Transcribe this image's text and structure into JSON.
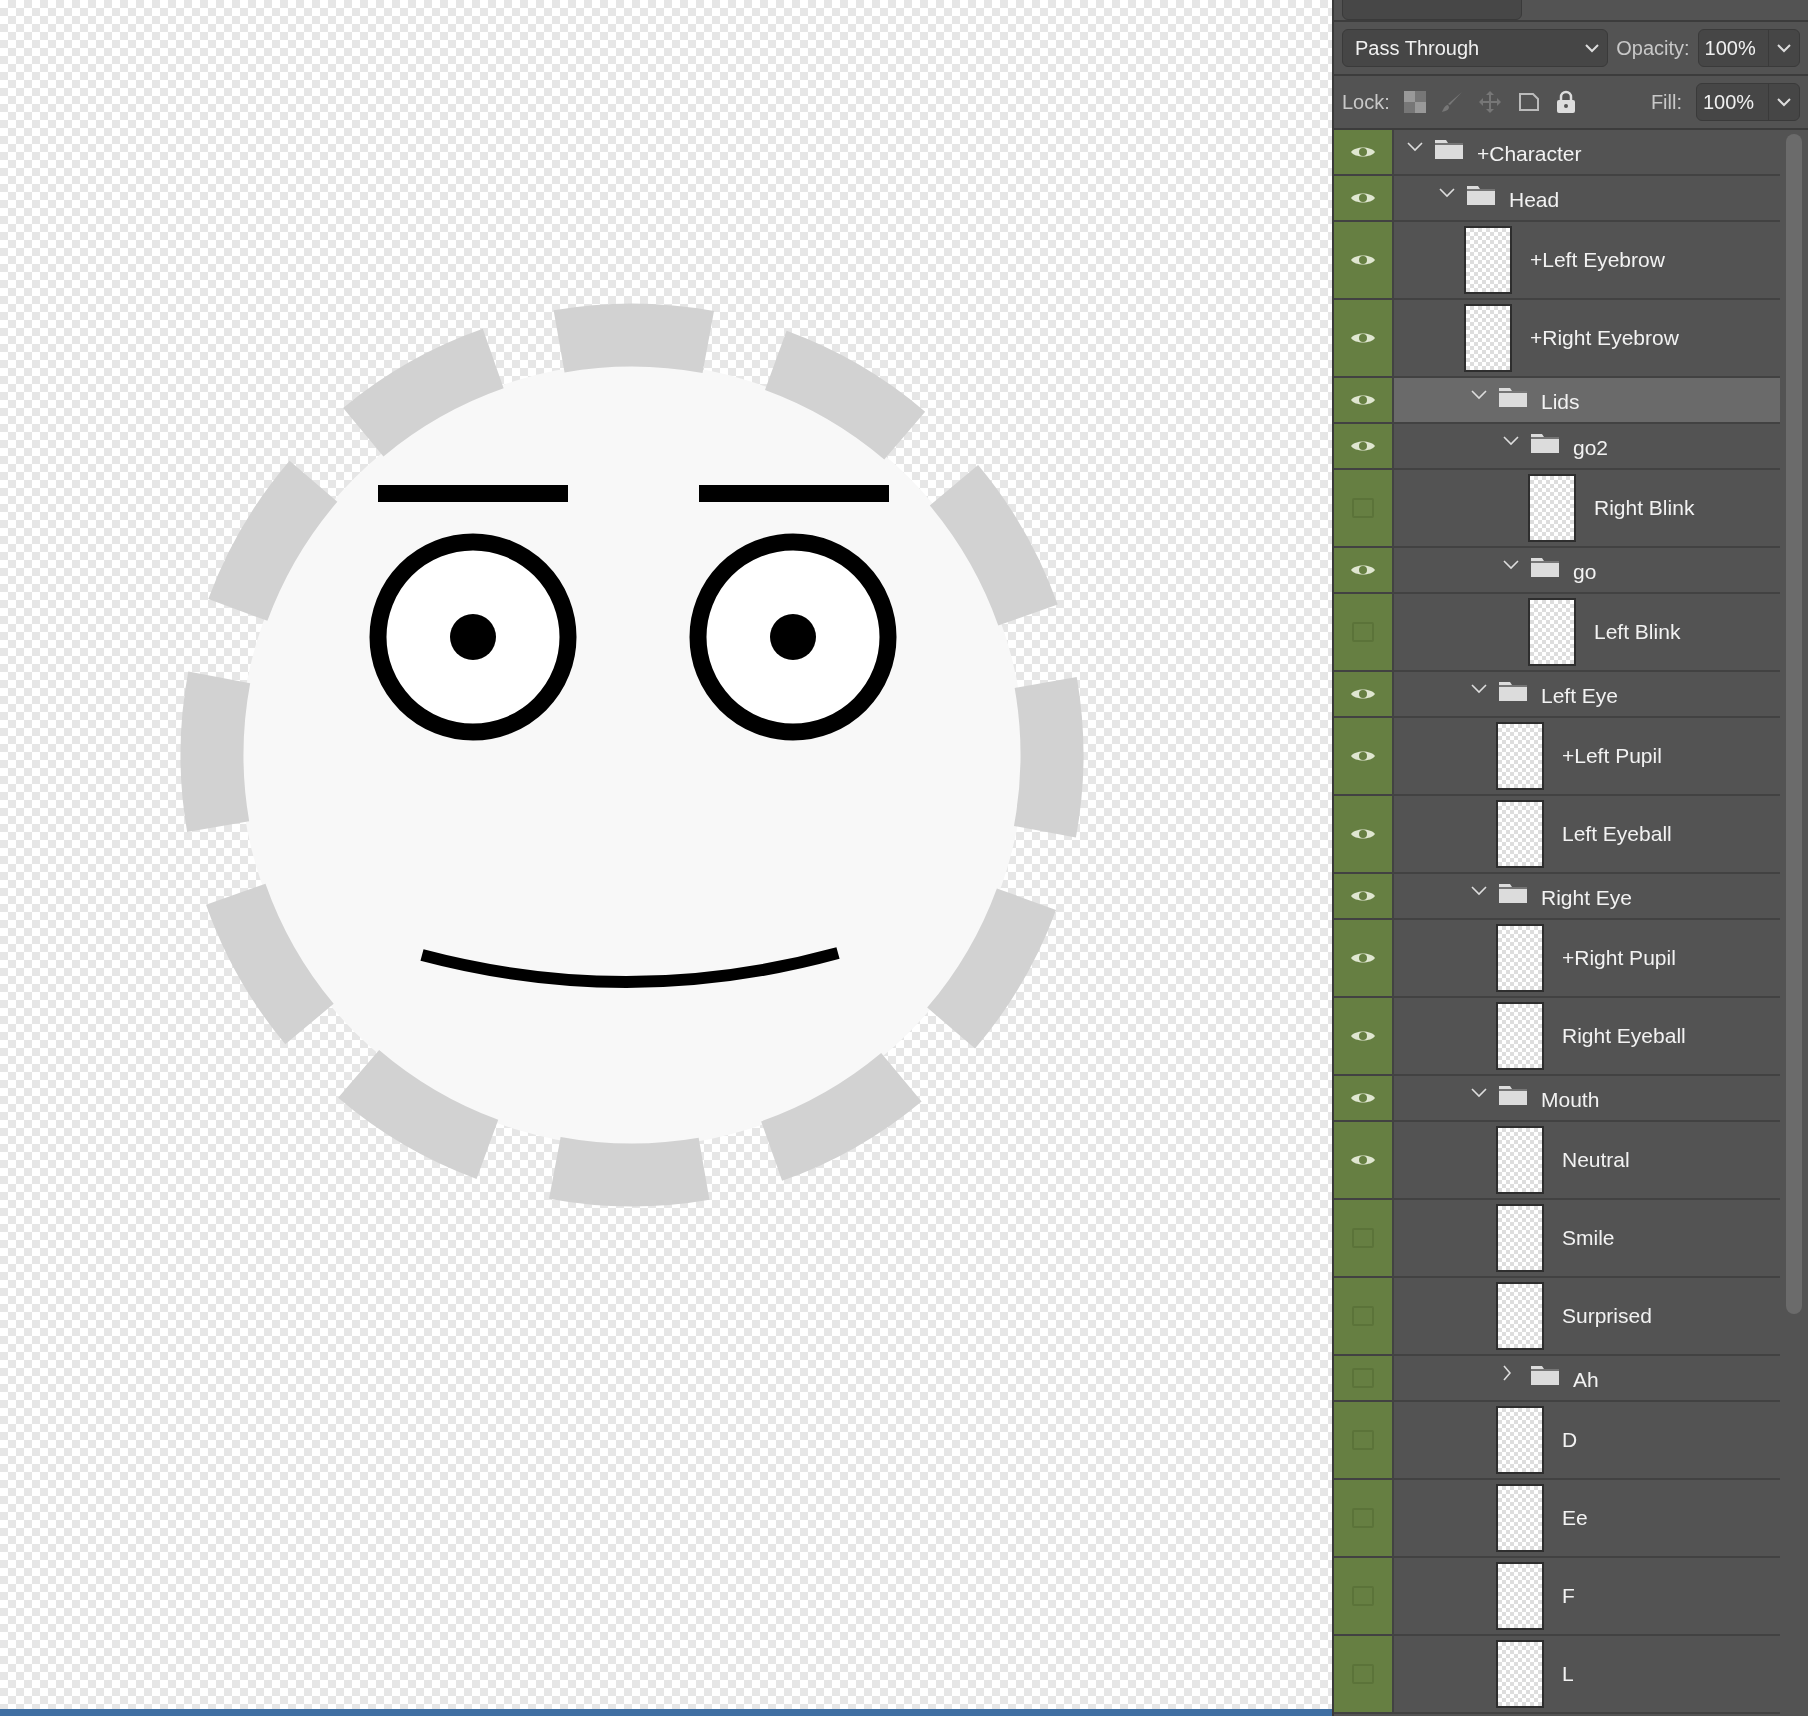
{
  "blend_mode": "Pass Through",
  "opacity": {
    "label": "Opacity:",
    "value": "100%"
  },
  "lock": {
    "label": "Lock:"
  },
  "fill": {
    "label": "Fill:",
    "value": "100%"
  },
  "layers": [
    {
      "name": "+Character",
      "kind": "group",
      "visible": true,
      "expanded": true,
      "selected": false,
      "children": [
        {
          "name": "Head",
          "kind": "group",
          "visible": true,
          "expanded": true,
          "selected": false,
          "children": [
            {
              "name": "+Left Eyebrow",
              "kind": "layer",
              "visible": true,
              "selected": false
            },
            {
              "name": "+Right Eyebrow",
              "kind": "layer",
              "visible": true,
              "selected": false
            },
            {
              "name": "Lids",
              "kind": "group",
              "visible": true,
              "expanded": true,
              "selected": true,
              "children": [
                {
                  "name": "go2",
                  "kind": "group",
                  "visible": true,
                  "expanded": true,
                  "selected": false,
                  "children": [
                    {
                      "name": "Right Blink",
                      "kind": "layer",
                      "visible": false,
                      "selected": false
                    }
                  ]
                },
                {
                  "name": "go",
                  "kind": "group",
                  "visible": true,
                  "expanded": true,
                  "selected": false,
                  "children": [
                    {
                      "name": "Left Blink",
                      "kind": "layer",
                      "visible": false,
                      "selected": false
                    }
                  ]
                }
              ]
            },
            {
              "name": "Left Eye",
              "kind": "group",
              "visible": true,
              "expanded": true,
              "selected": false,
              "children": [
                {
                  "name": "+Left Pupil",
                  "kind": "layer",
                  "visible": true,
                  "selected": false
                },
                {
                  "name": "Left Eyeball",
                  "kind": "layer",
                  "visible": true,
                  "selected": false
                }
              ]
            },
            {
              "name": "Right Eye",
              "kind": "group",
              "visible": true,
              "expanded": true,
              "selected": false,
              "children": [
                {
                  "name": "+Right Pupil",
                  "kind": "layer",
                  "visible": true,
                  "selected": false
                },
                {
                  "name": "Right Eyeball",
                  "kind": "layer",
                  "visible": true,
                  "selected": false
                }
              ]
            },
            {
              "name": "Mouth",
              "kind": "group",
              "visible": true,
              "expanded": true,
              "selected": false,
              "children": [
                {
                  "name": "Neutral",
                  "kind": "layer",
                  "visible": true,
                  "selected": false
                },
                {
                  "name": "Smile",
                  "kind": "layer",
                  "visible": false,
                  "selected": false
                },
                {
                  "name": "Surprised",
                  "kind": "layer",
                  "visible": false,
                  "selected": false
                },
                {
                  "name": "Ah",
                  "kind": "group",
                  "visible": false,
                  "expanded": false,
                  "selected": false
                },
                {
                  "name": "D",
                  "kind": "layer",
                  "visible": false,
                  "selected": false
                },
                {
                  "name": "Ee",
                  "kind": "layer",
                  "visible": false,
                  "selected": false
                },
                {
                  "name": "F",
                  "kind": "layer",
                  "visible": false,
                  "selected": false
                },
                {
                  "name": "L",
                  "kind": "layer",
                  "visible": false,
                  "selected": false
                }
              ]
            }
          ]
        }
      ]
    }
  ]
}
